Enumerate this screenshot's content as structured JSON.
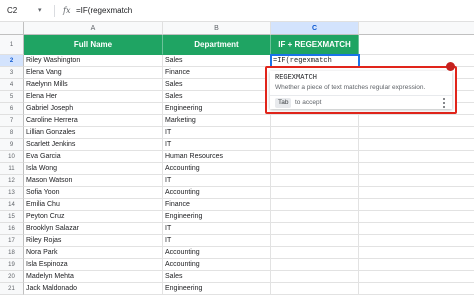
{
  "formula_bar": {
    "name_box": "C2",
    "fx_label": "fx",
    "formula": "=IF(regexmatch"
  },
  "columns": [
    "A",
    "B",
    "C"
  ],
  "rows": [
    {
      "num": "1",
      "a": "Full Name",
      "b": "Department",
      "c": "IF + REGEXMATCH"
    },
    {
      "num": "2",
      "a": "Riley Washington",
      "b": "Sales",
      "c": "=IF(regexmatch"
    },
    {
      "num": "3",
      "a": "Elena Vang",
      "b": "Finance",
      "c": ""
    },
    {
      "num": "4",
      "a": "Raelynn Mills",
      "b": "Sales",
      "c": ""
    },
    {
      "num": "5",
      "a": "Elena Her",
      "b": "Sales",
      "c": ""
    },
    {
      "num": "6",
      "a": "Gabriel Joseph",
      "b": "Engineering",
      "c": ""
    },
    {
      "num": "7",
      "a": "Caroline Herrera",
      "b": "Marketing",
      "c": ""
    },
    {
      "num": "8",
      "a": "Lillian Gonzales",
      "b": "IT",
      "c": ""
    },
    {
      "num": "9",
      "a": "Scarlett Jenkins",
      "b": "IT",
      "c": ""
    },
    {
      "num": "10",
      "a": "Eva Garcia",
      "b": "Human Resources",
      "c": ""
    },
    {
      "num": "11",
      "a": "Isla Wong",
      "b": "Accounting",
      "c": ""
    },
    {
      "num": "12",
      "a": "Mason Watson",
      "b": "IT",
      "c": ""
    },
    {
      "num": "13",
      "a": "Sofia Yoon",
      "b": "Accounting",
      "c": ""
    },
    {
      "num": "14",
      "a": "Emilia Chu",
      "b": "Finance",
      "c": ""
    },
    {
      "num": "15",
      "a": "Peyton Cruz",
      "b": "Engineering",
      "c": ""
    },
    {
      "num": "16",
      "a": "Brooklyn Salazar",
      "b": "IT",
      "c": ""
    },
    {
      "num": "17",
      "a": "Riley Rojas",
      "b": "IT",
      "c": ""
    },
    {
      "num": "18",
      "a": "Nora Park",
      "b": "Accounting",
      "c": ""
    },
    {
      "num": "19",
      "a": "Isla Espinoza",
      "b": "Accounting",
      "c": ""
    },
    {
      "num": "20",
      "a": "Madelyn Mehta",
      "b": "Sales",
      "c": ""
    },
    {
      "num": "21",
      "a": "Jack Maldonado",
      "b": "Engineering",
      "c": ""
    }
  ],
  "autocomplete": {
    "function_name": "REGEXMATCH",
    "description": "Whether a piece of text matches regular expression.",
    "tab_key": "Tab",
    "tab_hint": "to accept"
  },
  "colors": {
    "header_green": "#1fa463",
    "selection_blue": "#1a73e8",
    "highlight_red": "#e1251b"
  }
}
